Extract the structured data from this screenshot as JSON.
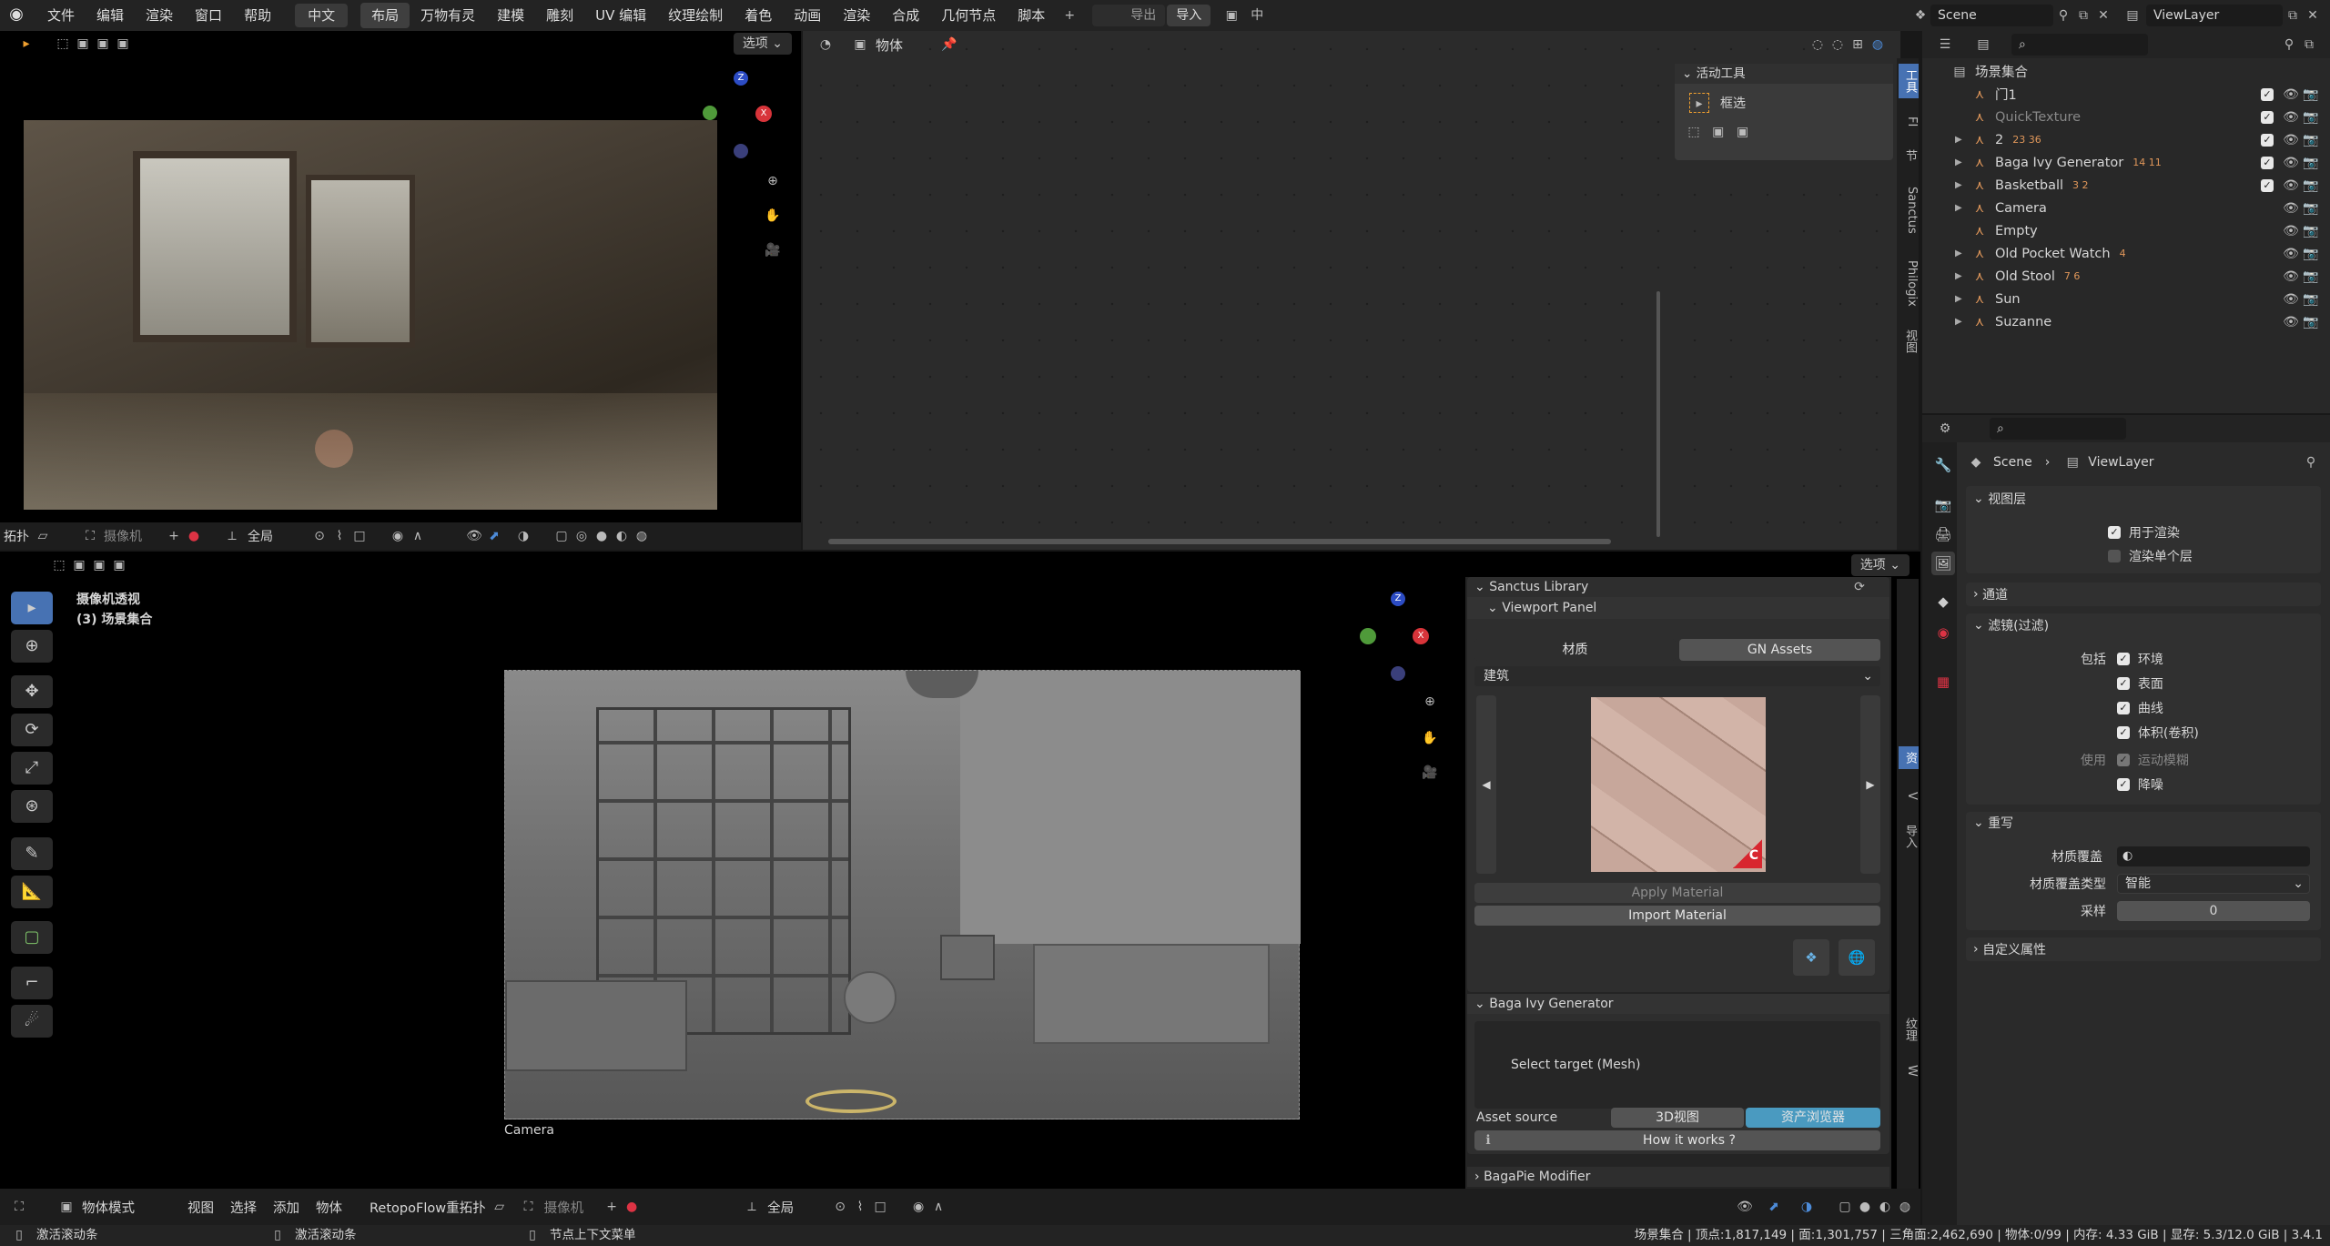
{
  "topbar": {
    "menus": [
      "文件",
      "编辑",
      "渲染",
      "窗口",
      "帮助"
    ],
    "language": "中文",
    "workspaces": [
      "布局",
      "万物有灵",
      "建模",
      "雕刻",
      "UV 编辑",
      "纹理绘制",
      "着色",
      "动画",
      "渲染",
      "合成",
      "几何节点",
      "脚本"
    ],
    "export_label": "导出",
    "import_label": "导入",
    "zh_label": "中",
    "scene": "Scene",
    "view_layer": "ViewLayer"
  },
  "top_left_view": {
    "options_label": "选项"
  },
  "node_editor": {
    "object_label": "物体",
    "active_tool_title": "活动工具",
    "tool_name": "框选",
    "side_tabs": [
      "工具",
      "FI",
      "节",
      "Sanctus",
      "Philogix",
      "视图"
    ]
  },
  "mid_header": {
    "mode_label": "拓扑",
    "camera_label": "摄像机",
    "global_label": "全局"
  },
  "main_viewport": {
    "options_label": "选项",
    "view_name": "摄像机透视",
    "collection": "(3) 场景集合",
    "camera_label": "Camera",
    "side_tabs": [
      "资",
      "V",
      "导入",
      "纹理",
      "W"
    ]
  },
  "sanctus": {
    "title": "Sanctus Library",
    "subpanel": "Viewport Panel",
    "tab_material": "材质",
    "tab_gn": "GN Assets",
    "category": "建筑",
    "apply_label": "Apply Material",
    "import_label": "Import Material",
    "logo_letter": "C"
  },
  "baga": {
    "title": "Baga Ivy Generator",
    "select_target": "Select target (Mesh)",
    "asset_source_label": "Asset source",
    "opt_3d": "3D视图",
    "opt_browser": "资产浏览器",
    "how_label": "How it works ?",
    "pie_title": "BagaPie Modifier"
  },
  "bottom_header": {
    "mode": "物体模式",
    "menus": [
      "视图",
      "选择",
      "添加",
      "物体"
    ],
    "retopo": "RetopoFlow重拓扑",
    "camera_label": "摄像机",
    "global_label": "全局"
  },
  "statusbar": {
    "hint1": "激活滚动条",
    "hint2": "激活滚动条",
    "hint3": "节点上下文菜单",
    "stats": "场景集合 | 顶点:1,817,149 | 面:1,301,757 | 三角面:2,462,690 | 物体:0/99 | 内存: 4.33 GiB | 显存: 5.3/12.0 GiB | 3.4.1"
  },
  "outliner": {
    "root": "场景集合",
    "items": [
      {
        "name": "门1",
        "expand": false,
        "badge": "",
        "muted": false
      },
      {
        "name": "QuickTexture",
        "expand": false,
        "badge": "",
        "muted": true
      },
      {
        "name": "2",
        "expand": true,
        "badge": "23 36",
        "muted": false
      },
      {
        "name": "Baga Ivy Generator",
        "expand": true,
        "badge": "14 11",
        "muted": false
      },
      {
        "name": "Basketball",
        "expand": true,
        "badge": "3 2",
        "muted": false
      },
      {
        "name": "Camera",
        "expand": true,
        "badge": "",
        "muted": false
      },
      {
        "name": "Empty",
        "expand": false,
        "badge": "",
        "muted": false
      },
      {
        "name": "Old Pocket Watch",
        "expand": true,
        "badge": "4",
        "muted": false
      },
      {
        "name": "Old Stool",
        "expand": true,
        "badge": "7 6",
        "muted": false
      },
      {
        "name": "Sun",
        "expand": true,
        "badge": "",
        "muted": false
      },
      {
        "name": "Suzanne",
        "expand": true,
        "badge": "",
        "muted": false
      }
    ]
  },
  "properties": {
    "breadcrumb_scene": "Scene",
    "breadcrumb_layer": "ViewLayer",
    "view_layer_title": "视图层",
    "use_render": "用于渲染",
    "render_single": "渲染单个层",
    "passes": "通道",
    "filter": "滤镜(过滤)",
    "include": "包括",
    "env": "环境",
    "surface": "表面",
    "curves": "曲线",
    "volume": "体积(卷积)",
    "use": "使用",
    "motion_blur": "运动模糊",
    "denoise": "降噪",
    "override": "重写",
    "mat_override": "材质覆盖",
    "mat_override_type": "材质覆盖类型",
    "mat_override_type_val": "智能",
    "samples": "采样",
    "samples_val": "0",
    "custom_props": "自定义属性"
  }
}
